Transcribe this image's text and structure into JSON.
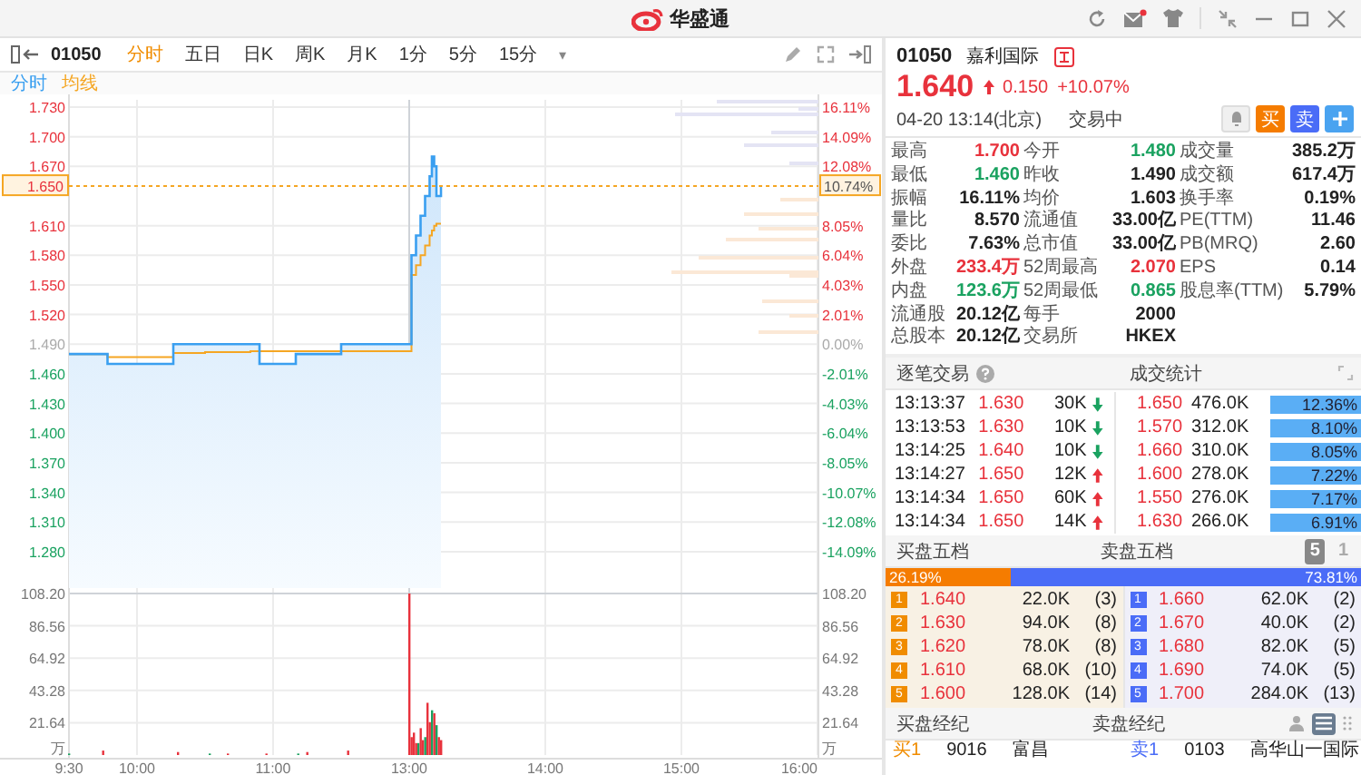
{
  "window": {
    "title": "华盛通"
  },
  "toolbar": {
    "symbol": "01050",
    "tabs": [
      {
        "label": "分时",
        "selected": true
      },
      {
        "label": "五日",
        "selected": false
      },
      {
        "label": "日K",
        "selected": false
      },
      {
        "label": "周K",
        "selected": false
      },
      {
        "label": "月K",
        "selected": false
      },
      {
        "label": "1分",
        "selected": false
      },
      {
        "label": "5分",
        "selected": false
      },
      {
        "label": "15分",
        "selected": false
      }
    ],
    "more": "▾"
  },
  "legend": [
    {
      "label": "分时",
      "color": "#3a9ff0"
    },
    {
      "label": "均线",
      "color": "#f5a623"
    }
  ],
  "price_chart": {
    "price_axis": [
      {
        "label": "1.730",
        "color": "#e8323c"
      },
      {
        "label": "1.700",
        "color": "#e8323c"
      },
      {
        "label": "1.670",
        "color": "#e8323c"
      },
      {
        "label": "1.610",
        "color": "#e8323c"
      },
      {
        "label": "1.580",
        "color": "#e8323c"
      },
      {
        "label": "1.550",
        "color": "#e8323c"
      },
      {
        "label": "1.520",
        "color": "#e8323c"
      },
      {
        "label": "1.490",
        "color": "#aaaaaa"
      },
      {
        "label": "1.460",
        "color": "#1aa260"
      },
      {
        "label": "1.430",
        "color": "#1aa260"
      },
      {
        "label": "1.400",
        "color": "#1aa260"
      },
      {
        "label": "1.370",
        "color": "#1aa260"
      },
      {
        "label": "1.340",
        "color": "#1aa260"
      },
      {
        "label": "1.310",
        "color": "#1aa260"
      },
      {
        "label": "1.280",
        "color": "#1aa260"
      }
    ],
    "percent_axis": [
      {
        "label": "16.11%",
        "color": "#e8323c"
      },
      {
        "label": "14.09%",
        "color": "#e8323c"
      },
      {
        "label": "12.08%",
        "color": "#e8323c"
      },
      {
        "label": "8.05%",
        "color": "#e8323c"
      },
      {
        "label": "6.04%",
        "color": "#e8323c"
      },
      {
        "label": "4.03%",
        "color": "#e8323c"
      },
      {
        "label": "2.01%",
        "color": "#e8323c"
      },
      {
        "label": "0.00%",
        "color": "#aaaaaa"
      },
      {
        "label": "-2.01%",
        "color": "#1aa260"
      },
      {
        "label": "-4.03%",
        "color": "#1aa260"
      },
      {
        "label": "-6.04%",
        "color": "#1aa260"
      },
      {
        "label": "-8.05%",
        "color": "#1aa260"
      },
      {
        "label": "-10.07%",
        "color": "#1aa260"
      },
      {
        "label": "-12.08%",
        "color": "#1aa260"
      },
      {
        "label": "-14.09%",
        "color": "#1aa260"
      }
    ],
    "current_price": "1.650",
    "current_percent": "10.74%",
    "time_axis": [
      "9:30",
      "10:00",
      "11:00",
      "13:00",
      "14:00",
      "15:00",
      "16:00"
    ]
  },
  "volume_chart": {
    "left_labels": [
      "108.20",
      "86.56",
      "64.92",
      "43.28",
      "21.64"
    ],
    "left_unit": "万",
    "right_labels": [
      "108.20",
      "86.56",
      "64.92",
      "43.28",
      "21.64"
    ],
    "right_unit": "万"
  },
  "quote": {
    "code": "01050",
    "name": "嘉利国际",
    "price": "1.640",
    "change": "0.150",
    "change_percent": "+10.07%",
    "color": "#e8323c",
    "time": "04-20 13:14(北京)",
    "status": "交易中",
    "buy_button": "买",
    "sell_button": "卖"
  },
  "stats": [
    [
      {
        "label": "最高",
        "value": "1.700",
        "color": "#e8323c"
      },
      {
        "label": "今开",
        "value": "1.480",
        "color": "#1aa260"
      },
      {
        "label": "成交量",
        "value": "385.2万",
        "color": "#222222"
      }
    ],
    [
      {
        "label": "最低",
        "value": "1.460",
        "color": "#1aa260"
      },
      {
        "label": "昨收",
        "value": "1.490",
        "color": "#222222"
      },
      {
        "label": "成交额",
        "value": "617.4万",
        "color": "#222222"
      }
    ],
    [
      {
        "label": "振幅",
        "value": "16.11%",
        "color": "#222222"
      },
      {
        "label": "均价",
        "value": "1.603",
        "color": "#222222"
      },
      {
        "label": "换手率",
        "value": "0.19%",
        "color": "#222222"
      }
    ],
    [
      {
        "label": "量比",
        "value": "8.570",
        "color": "#222222"
      },
      {
        "label": "流通值",
        "value": "33.00亿",
        "color": "#222222"
      },
      {
        "label": "PE(TTM)",
        "value": "11.46",
        "color": "#222222"
      }
    ],
    [
      {
        "label": "委比",
        "value": "7.63%",
        "color": "#222222"
      },
      {
        "label": "总市值",
        "value": "33.00亿",
        "color": "#222222"
      },
      {
        "label": "PB(MRQ)",
        "value": "2.60",
        "color": "#222222"
      }
    ],
    [
      {
        "label": "外盘",
        "value": "233.4万",
        "color": "#e8323c"
      },
      {
        "label": "52周最高",
        "value": "2.070",
        "color": "#e8323c"
      },
      {
        "label": "EPS",
        "value": "0.14",
        "color": "#222222"
      }
    ],
    [
      {
        "label": "内盘",
        "value": "123.6万",
        "color": "#1aa260"
      },
      {
        "label": "52周最低",
        "value": "0.865",
        "color": "#1aa260"
      },
      {
        "label": "股息率(TTM)",
        "value": "5.79%",
        "color": "#222222"
      }
    ],
    [
      {
        "label": "流通股",
        "value": "20.12亿",
        "color": "#222222"
      },
      {
        "label": "每手",
        "value": "2000",
        "color": "#222222"
      }
    ],
    [
      {
        "label": "总股本",
        "value": "20.12亿",
        "color": "#222222"
      },
      {
        "label": "交易所",
        "value": "HKEX",
        "color": "#222222"
      }
    ]
  ],
  "trades": {
    "title": "逐笔交易",
    "stats_title": "成交统计",
    "rows": [
      {
        "time": "13:13:37",
        "price": "1.630",
        "volume": "30K",
        "kind": "down"
      },
      {
        "time": "13:13:53",
        "price": "1.630",
        "volume": "10K",
        "kind": "down"
      },
      {
        "time": "13:14:25",
        "price": "1.640",
        "volume": "10K",
        "kind": "down"
      },
      {
        "time": "13:14:27",
        "price": "1.650",
        "volume": "12K",
        "kind": "up"
      },
      {
        "time": "13:14:34",
        "price": "1.650",
        "volume": "60K",
        "kind": "up"
      },
      {
        "time": "13:14:34",
        "price": "1.650",
        "volume": "14K",
        "kind": "up"
      }
    ],
    "stats": [
      {
        "price": "1.650",
        "volume": "476.0K",
        "percent": "12.36%"
      },
      {
        "price": "1.570",
        "volume": "312.0K",
        "percent": "8.10%"
      },
      {
        "price": "1.660",
        "volume": "310.0K",
        "percent": "8.05%"
      },
      {
        "price": "1.600",
        "volume": "278.0K",
        "percent": "7.22%"
      },
      {
        "price": "1.550",
        "volume": "276.0K",
        "percent": "7.17%"
      },
      {
        "price": "1.630",
        "volume": "266.0K",
        "percent": "6.91%"
      }
    ]
  },
  "depth": {
    "bid_title": "买盘五档",
    "ask_title": "卖盘五档",
    "levels": [
      {
        "label": "5",
        "selected": true
      },
      {
        "label": "1",
        "selected": false
      }
    ],
    "bid_share": "26.19%",
    "ask_share": "73.81%",
    "level": 0.2619,
    "bids": [
      {
        "rank": "1",
        "price": "1.640",
        "volume": "22.0K",
        "orders": "(3)"
      },
      {
        "rank": "2",
        "price": "1.630",
        "volume": "94.0K",
        "orders": "(8)"
      },
      {
        "rank": "3",
        "price": "1.620",
        "volume": "78.0K",
        "orders": "(8)"
      },
      {
        "rank": "4",
        "price": "1.610",
        "volume": "68.0K",
        "orders": "(10)"
      },
      {
        "rank": "5",
        "price": "1.600",
        "volume": "128.0K",
        "orders": "(14)"
      }
    ],
    "asks": [
      {
        "rank": "1",
        "price": "1.660",
        "volume": "62.0K",
        "orders": "(2)"
      },
      {
        "rank": "2",
        "price": "1.670",
        "volume": "40.0K",
        "orders": "(2)"
      },
      {
        "rank": "3",
        "price": "1.680",
        "volume": "82.0K",
        "orders": "(5)"
      },
      {
        "rank": "4",
        "price": "1.690",
        "volume": "74.0K",
        "orders": "(5)"
      },
      {
        "rank": "5",
        "price": "1.700",
        "volume": "284.0K",
        "orders": "(13)"
      }
    ]
  },
  "brokers": {
    "bid_title": "买盘经纪",
    "ask_title": "卖盘经纪",
    "bid_row": {
      "rank": "买1",
      "id": "9016",
      "name": "富昌"
    },
    "ask_row": {
      "rank": "卖1",
      "id": "0103",
      "name": "高华山一国际"
    }
  }
}
